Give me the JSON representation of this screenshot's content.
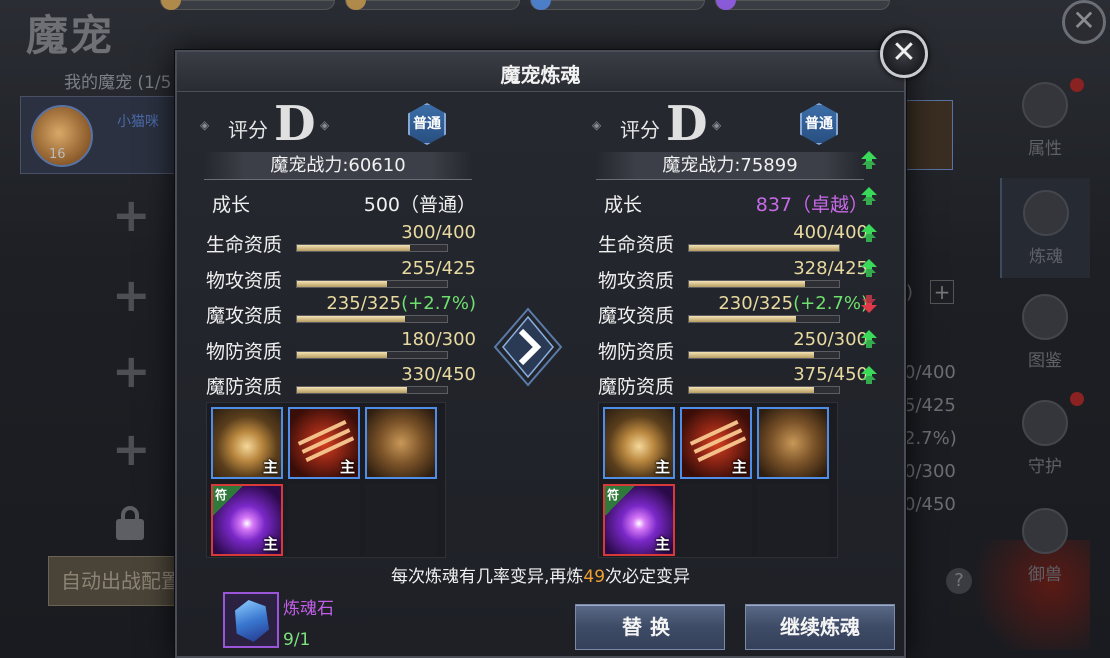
{
  "background": {
    "title": "魔宠",
    "my_pets_label": "我的魔宠 (1/5",
    "pet_card": {
      "level": "16",
      "name": "小猫咪"
    },
    "auto_deploy_label": "自动出战配置",
    "side_tabs": [
      {
        "label": "属性",
        "icon": "attribute-icon"
      },
      {
        "label": "炼魂",
        "icon": "soul-refine-icon"
      },
      {
        "label": "图鉴",
        "icon": "codex-icon"
      },
      {
        "label": "守护",
        "icon": "guard-icon"
      },
      {
        "label": "御兽",
        "icon": "beast-tame-icon"
      }
    ],
    "stat_fragments": [
      "0/400",
      "5/425",
      "2.7%)",
      "0/300",
      "0/450"
    ],
    "paren_fragment": ")",
    "help_symbol": "?",
    "close_symbol": "✕"
  },
  "dialog": {
    "title": "魔宠炼魂",
    "close_symbol": "✕",
    "grade_label": "评分",
    "hint_prefix": "每次炼魂有几率变异,再炼",
    "hint_count": "49",
    "hint_suffix": "次必定变异",
    "stone_name": "炼魂石",
    "stone_count": "9/1",
    "replace_button": "替换",
    "continue_button": "继续炼魂"
  },
  "left": {
    "grade": "D",
    "quality_badge": "普通",
    "power": "魔宠战力:60610",
    "growth_label": "成长",
    "growth_value": "500（普通）",
    "stats": [
      {
        "label": "生命资质",
        "value": "300/400",
        "fill": 0.75
      },
      {
        "label": "物攻资质",
        "value": "255/425",
        "fill": 0.6
      },
      {
        "label": "魔攻资质",
        "value": "235/325",
        "bonus": "(+2.7%)",
        "fill": 0.72
      },
      {
        "label": "物防资质",
        "value": "180/300",
        "fill": 0.6
      },
      {
        "label": "魔防资质",
        "value": "330/450",
        "fill": 0.73
      }
    ],
    "skills": [
      {
        "art": "gold",
        "tag": "主",
        "border": "blue"
      },
      {
        "art": "claw",
        "tag": "主",
        "border": "blue"
      },
      {
        "art": "bear",
        "tag": "",
        "border": "blue"
      },
      {
        "art": "purple",
        "tag": "主",
        "border": "red",
        "corner": "符"
      }
    ]
  },
  "right": {
    "grade": "D",
    "quality_badge": "普通",
    "power": "魔宠战力:75899",
    "growth_label": "成长",
    "growth_value": "837（卓越）",
    "stats": [
      {
        "label": "生命资质",
        "value": "400/400",
        "fill": 1.0,
        "trend": "up"
      },
      {
        "label": "物攻资质",
        "value": "328/425",
        "fill": 0.77,
        "trend": "up"
      },
      {
        "label": "魔攻资质",
        "value": "230/325",
        "bonus": "(+2.7%)",
        "fill": 0.71,
        "trend": "down"
      },
      {
        "label": "物防资质",
        "value": "250/300",
        "fill": 0.83,
        "trend": "up"
      },
      {
        "label": "魔防资质",
        "value": "375/450",
        "fill": 0.83,
        "trend": "up"
      }
    ],
    "power_trend": "up",
    "growth_trend": "up",
    "skills": [
      {
        "art": "gold",
        "tag": "主",
        "border": "blue"
      },
      {
        "art": "claw",
        "tag": "主",
        "border": "blue"
      },
      {
        "art": "bear",
        "tag": "",
        "border": "blue"
      },
      {
        "art": "purple",
        "tag": "主",
        "border": "red",
        "corner": "符"
      }
    ]
  },
  "colors": {
    "trend_up": "#3bd95a",
    "trend_down": "#e0394a",
    "excellent": "#c76ae8",
    "bonus": "#6ee06e",
    "highlight_number": "#f0a030"
  }
}
